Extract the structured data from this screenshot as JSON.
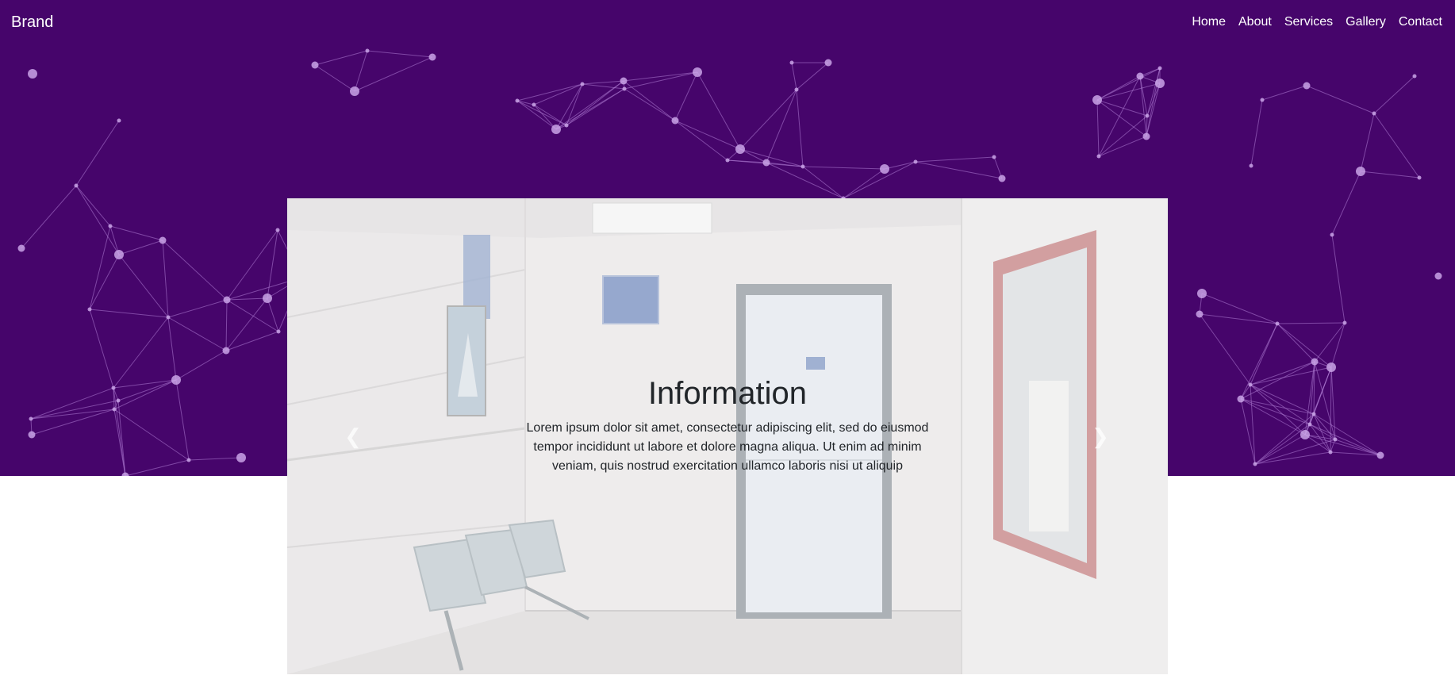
{
  "navbar": {
    "brand": "Brand",
    "links": [
      "Home",
      "About",
      "Services",
      "Gallery",
      "Contact"
    ]
  },
  "carousel": {
    "title": "Information",
    "text": "Lorem ipsum dolor sit amet, consectetur adipiscing elit, sed do eiusmod tempor incididunt ut labore et dolore magna aliqua. Ut enim ad minim veniam, quis nostrud exercitation ullamco laboris nisi ut aliquip",
    "prev_icon": "chevron-left-icon",
    "next_icon": "chevron-right-icon"
  },
  "colors": {
    "hero_background": "#46056b",
    "network_line": "#b07ed6",
    "network_node": "#c9a3e6",
    "caption_text": "#212529"
  }
}
